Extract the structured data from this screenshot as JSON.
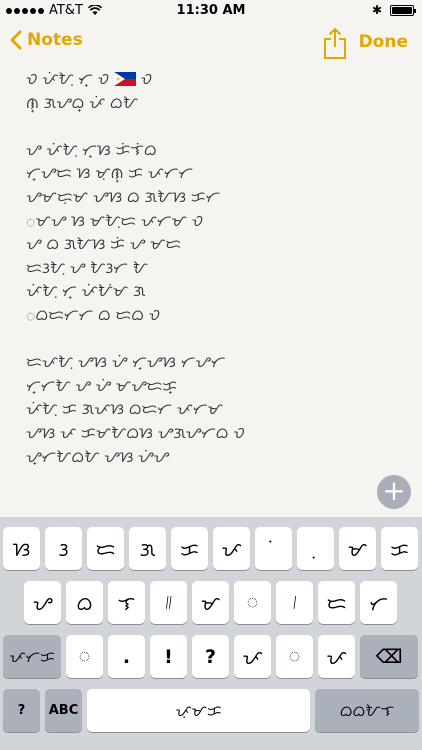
{
  "status": {
    "carrier": "AT&T",
    "time": "11:30 AM",
    "bluetooth": "✱"
  },
  "nav": {
    "back_label": "Notes",
    "done_label": "Done"
  },
  "note_lines": [
    "ᜏ ᜉᜒᜀᜓ ᜆ᜔ ᜏ",
    "ᜈ᜔ ᜄᜌᜊ᜔ ᜉᜒ ᜊᜀ",
    "",
    "ᜌ ᜉᜒᜀᜓ ᜆ᜔ᜐ ᜃᜒᜎᜒᜊ",
    "ᜆ᜔ᜌᜇ ᜐ ᜋᜓᜈ᜔ ᜃ ᜉᜆᜆ",
    "ᜌᜋᜇᜓᜋ ᜌᜐ ᜊ ᜄᜀᜐ ᜃᜆ",
    "ᜀᜋᜌ ᜐ ᜋᜀᜓᜇ ᜉᜆᜋ ᜏ",
    "ᜌ ᜊ ᜄᜀᜐ ᜃᜒ ᜌ ᜋᜇ",
    "ᜇᜂᜀᜓ ᜌ ᜀᜂᜆ ᜀ",
    "ᜉᜒᜀᜓ ᜆ᜔ ᜉᜒᜀᜒᜋ ᜄ",
    "ᜀᜊᜇᜆᜆ ᜊ ᜇᜊ ᜏ",
    "",
    "ᜇᜉᜀᜓ ᜌᜐ ᜌᜒ ᜆ᜔ᜌᜐ ᜆᜌᜆ",
    "ᜆ᜔ᜆᜀ ᜌ ᜌᜒ ᜋᜌᜇᜃ᜔",
    "ᜉᜒᜀᜓ ᜃ ᜄᜉᜐ ᜊᜇᜆ ᜉᜆᜋ",
    "ᜌᜐ ᜉ ᜃᜋᜀᜊᜐ ᜌᜄᜌᜆᜊ ᜏ",
    "ᜌ᜔ᜆᜀᜊᜀ ᜌᜐ ᜌᜒᜌ"
  ],
  "add_button_label": "+",
  "keyboard": {
    "row1": [
      "ᜐ",
      "ᜂ",
      "ᜇ",
      "ᜄ",
      "ᜃ",
      "ᜉ",
      "ᜒ",
      "ᜓ",
      "ᜋ",
      "ᜃ"
    ],
    "row2": [
      "ᜌ",
      "ᜊ",
      "ᜎ",
      "᜶",
      "ᜋ",
      "ᜀ",
      "᜵",
      "ᜇ",
      "ᜆ"
    ],
    "row3_left": "ᜉᜆᜃ",
    "row3": [
      "ᜀ",
      ".",
      "!",
      "?",
      "ᜉ",
      "ᜀ",
      "ᜉ"
    ],
    "delete_label": "⌫",
    "question_label": "?",
    "abc_label": "ABC",
    "space_label": "ᜉᜓᜋᜃ",
    "return_label": "ᜊᜊᜀᜎ"
  },
  "colors": {
    "accent": "#e0a800",
    "paper": "#f5f4f1",
    "keyboard_bg": "#d1d4d9",
    "dark_key": "#abb1ba"
  }
}
